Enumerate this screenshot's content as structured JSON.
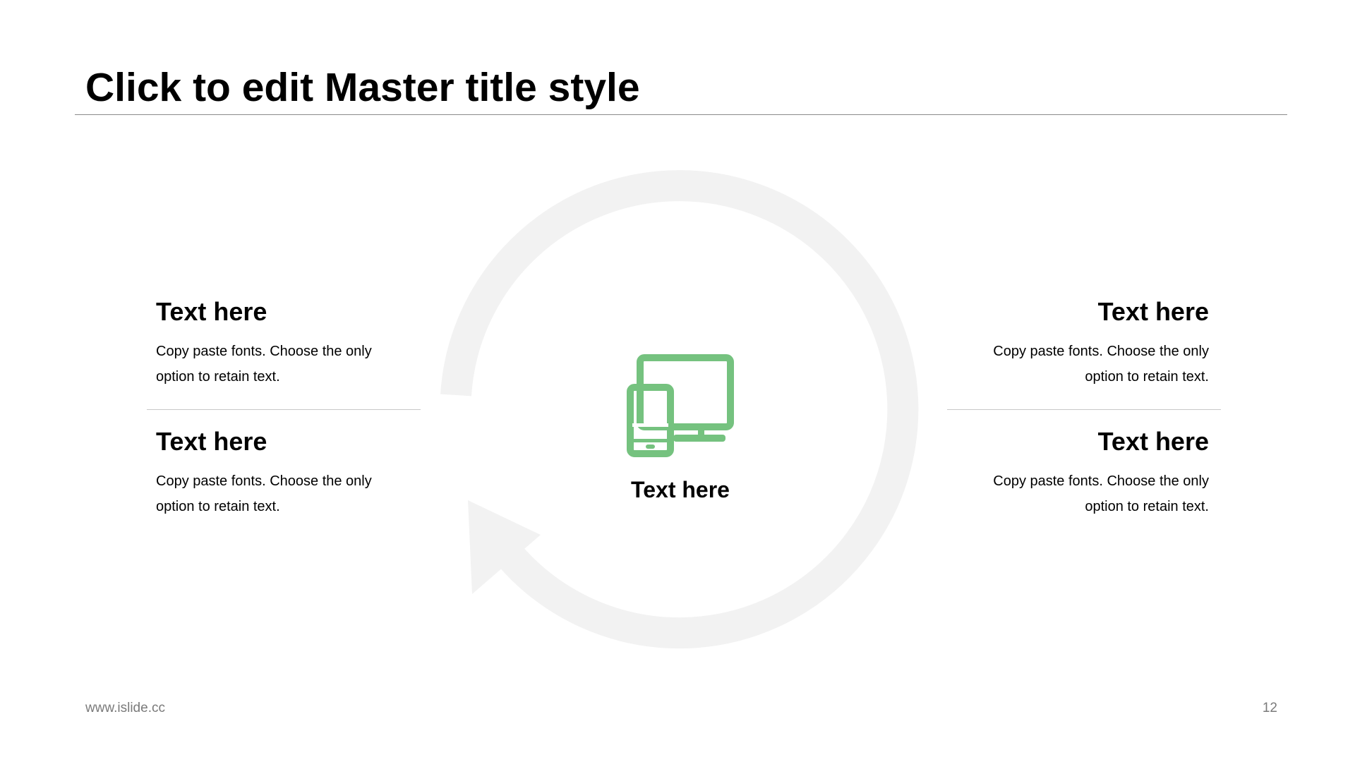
{
  "slide": {
    "title": "Click to edit Master title style",
    "center": {
      "label": "Text here",
      "icon": "devices-icon"
    },
    "blocks": [
      {
        "heading": "Text here",
        "line1": "Copy paste fonts. Choose the only",
        "line2": "option to retain text."
      },
      {
        "heading": "Text here",
        "line1": "Copy paste fonts. Choose the only",
        "line2": "option to retain text."
      },
      {
        "heading": "Text here",
        "line1": "Copy paste fonts. Choose the only",
        "line2": "option to retain text."
      },
      {
        "heading": "Text here",
        "line1": "Copy paste fonts. Choose the only",
        "line2": "option to retain text."
      }
    ]
  },
  "footer": {
    "url": "www.islide.cc",
    "page_number": "12"
  },
  "colors": {
    "accent": "#75c27f",
    "ring": "#f2f2f2",
    "rule": "#8a8a8a",
    "divider": "#c8c8c8",
    "footer_text": "#7a7a7a"
  }
}
